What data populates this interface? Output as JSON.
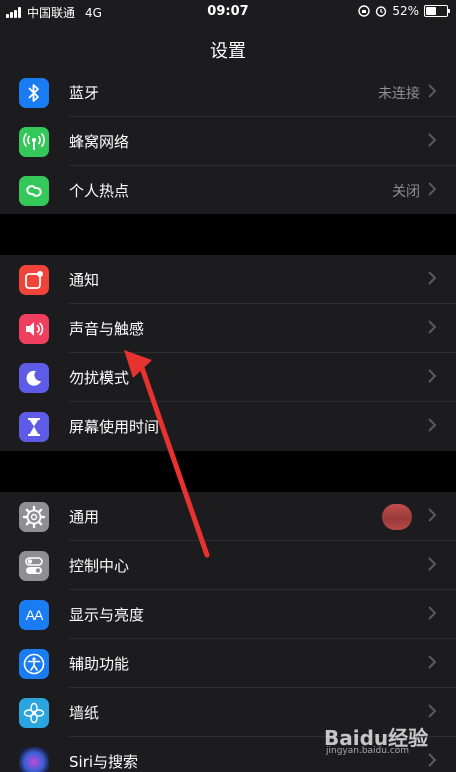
{
  "status_bar": {
    "carrier": "中国联通",
    "network": "4G",
    "time": "09:07",
    "battery": "52%",
    "battery_level": 0.52
  },
  "nav": {
    "title": "设置"
  },
  "groups": [
    {
      "items": [
        {
          "name": "bluetooth",
          "label": "蓝牙",
          "value": "未连接",
          "icon": "bluetooth-icon",
          "color": "#1a7cf2"
        },
        {
          "name": "cellular",
          "label": "蜂窝网络",
          "value": "",
          "icon": "antenna-icon",
          "color": "#34c759"
        },
        {
          "name": "hotspot",
          "label": "个人热点",
          "value": "关闭",
          "icon": "hotspot-link-icon",
          "color": "#34c759"
        }
      ]
    },
    {
      "items": [
        {
          "name": "notifications",
          "label": "通知",
          "value": "",
          "icon": "notification-icon",
          "color": "#f0443a"
        },
        {
          "name": "sounds",
          "label": "声音与触感",
          "value": "",
          "icon": "speaker-icon",
          "color": "#f03e5e"
        },
        {
          "name": "do-not-disturb",
          "label": "勿扰模式",
          "value": "",
          "icon": "moon-icon",
          "color": "#5e5ce6"
        },
        {
          "name": "screen-time",
          "label": "屏幕使用时间",
          "value": "",
          "icon": "hourglass-icon",
          "color": "#5e5ce6"
        }
      ]
    },
    {
      "items": [
        {
          "name": "general",
          "label": "通用",
          "value": "",
          "icon": "gear-icon",
          "color": "#8e8e93"
        },
        {
          "name": "control-center",
          "label": "控制中心",
          "value": "",
          "icon": "toggles-icon",
          "color": "#8e8e93"
        },
        {
          "name": "display",
          "label": "显示与亮度",
          "value": "",
          "icon": "text-size-icon",
          "color": "#1a7cf2"
        },
        {
          "name": "accessibility",
          "label": "辅助功能",
          "value": "",
          "icon": "accessibility-icon",
          "color": "#1a7cf2"
        },
        {
          "name": "wallpaper",
          "label": "墙纸",
          "value": "",
          "icon": "flower-icon",
          "color": "#2aa5e0"
        },
        {
          "name": "siri",
          "label": "Siri与搜索",
          "value": "",
          "icon": "siri-icon",
          "color": "#1b1b3a"
        }
      ]
    }
  ],
  "icon_text": {
    "display": "AA"
  },
  "watermark": {
    "brand": "Baidu经验",
    "url": "jingyan.baidu.com"
  },
  "annotation": {
    "arrow_color": "#e8322f"
  }
}
